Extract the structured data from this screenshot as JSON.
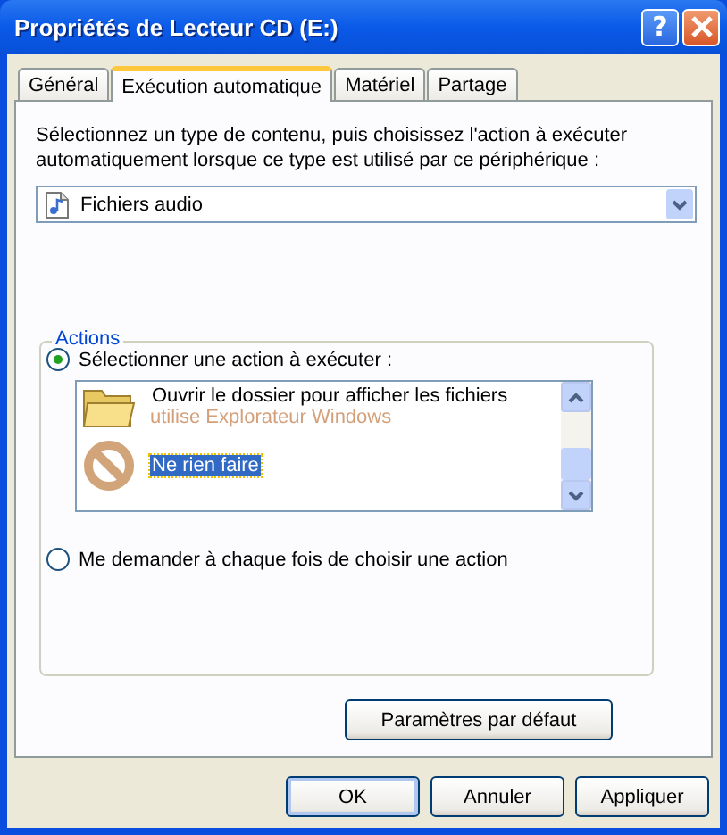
{
  "window": {
    "title": "Propriétés de Lecteur CD (E:)",
    "help": "?"
  },
  "tabs": [
    {
      "label": "Général",
      "selected": false
    },
    {
      "label": "Exécution automatique",
      "selected": true
    },
    {
      "label": "Matériel",
      "selected": false
    },
    {
      "label": "Partage",
      "selected": false
    }
  ],
  "intro": "Sélectionnez un type de contenu, puis choisissez l'action à exécuter automatiquement lorsque ce type est utilisé par ce périphérique :",
  "content_type": {
    "value": "Fichiers audio"
  },
  "actions": {
    "title": "Actions",
    "options": [
      {
        "label": "Sélectionner une action à exécuter :",
        "selected": true
      },
      {
        "label": "Me demander à chaque fois de choisir une action",
        "selected": false
      }
    ],
    "list": [
      {
        "kind": "folder",
        "title": "Ouvrir le dossier pour afficher les fichiers",
        "subtitle": "utilise Explorateur Windows",
        "selected": false
      },
      {
        "kind": "none",
        "title": "Ne rien faire",
        "selected": true
      }
    ]
  },
  "defaults_button": "Paramètres par défaut",
  "buttons": [
    {
      "label": "OK",
      "default": true
    },
    {
      "label": "Annuler",
      "default": false
    },
    {
      "label": "Appliquer",
      "default": false
    }
  ]
}
